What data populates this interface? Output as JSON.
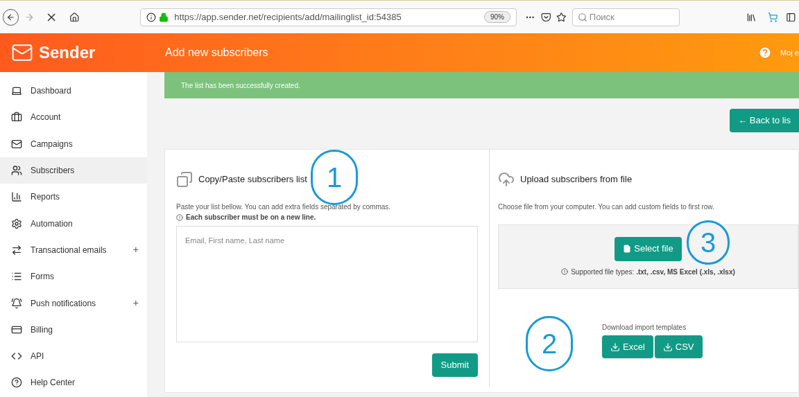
{
  "browser": {
    "url": "https://app.sender.net/recipients/add/mailinglist_id:54385",
    "zoom": "90%",
    "search_placeholder": "Поиск"
  },
  "header": {
    "logo": "Sender",
    "title": "Add new subscribers",
    "account": "Moj e"
  },
  "sidebar": {
    "items": [
      {
        "label": "Dashboard",
        "selected": false
      },
      {
        "label": "Account",
        "selected": false
      },
      {
        "label": "Campaigns",
        "selected": false
      },
      {
        "label": "Subscribers",
        "selected": true
      },
      {
        "label": "Reports",
        "selected": false
      },
      {
        "label": "Automation",
        "selected": false
      },
      {
        "label": "Transactional emails",
        "selected": false,
        "expand_mark": "+"
      },
      {
        "label": "Forms",
        "selected": false
      },
      {
        "label": "Push notifications",
        "selected": false,
        "expand_mark": "+"
      },
      {
        "label": "Billing",
        "selected": false
      },
      {
        "label": "API",
        "selected": false
      },
      {
        "label": "Help Center",
        "selected": false
      }
    ]
  },
  "alert": "The list has been successfully created.",
  "back_button": "← Back to lis",
  "paste_panel": {
    "title": "Copy/Paste subscribers list",
    "description": "Paste your list bellow. You can add extra fields separated by commas.",
    "note": "Each subscriber must be on a new line.",
    "placeholder": "Email, First name, Last name",
    "submit": "Submit"
  },
  "upload_panel": {
    "title": "Upload subscribers from file",
    "description": "Choose file from your computer. You can add custom fields to first row.",
    "select_button": "Select file",
    "supported": "Supported file types: **.txt, .csv, MS Excel (.xls, .xlsx)**",
    "templates_label": "Download import templates",
    "template_buttons": [
      "Excel",
      "CSV"
    ]
  },
  "annotations": [
    "1",
    "2",
    "3"
  ]
}
